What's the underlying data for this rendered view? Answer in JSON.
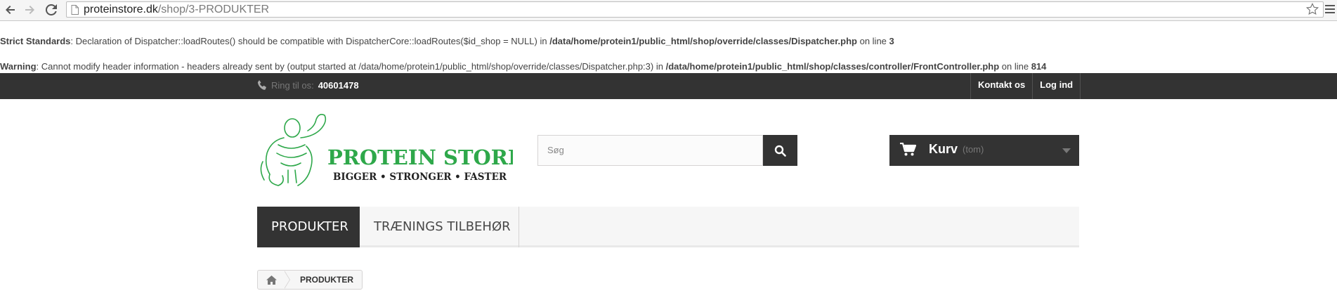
{
  "browser": {
    "url_domain": "proteinstore.dk",
    "url_path": "/shop/3-PRODUKTER"
  },
  "warnings": [
    {
      "label": "Strict Standards",
      "text": ": Declaration of Dispatcher::loadRoutes() should be compatible with DispatcherCore::loadRoutes($id_shop = NULL) in ",
      "file": "/data/home/protein1/public_html/shop/override/classes/Dispatcher.php",
      "line_text": " on line ",
      "line": "3"
    },
    {
      "label": "Warning",
      "text": ": Cannot modify header information - headers already sent by (output started at /data/home/protein1/public_html/shop/override/classes/Dispatcher.php:3) in ",
      "file": "/data/home/protein1/public_html/shop/classes/controller/FrontController.php",
      "line_text": " on line ",
      "line": "814"
    }
  ],
  "topbar": {
    "phone_label": "Ring til os:",
    "phone_number": "40601478",
    "links": [
      "Kontakt os",
      "Log ind"
    ]
  },
  "logo": {
    "title": "PROTEIN STORE",
    "tagline": "BIGGER • STRONGER • FASTER",
    "color": "#2ea84a"
  },
  "search": {
    "placeholder": "Søg"
  },
  "cart": {
    "label": "Kurv",
    "status": "(tom)"
  },
  "menu": {
    "items": [
      "PRODUKTER",
      "TRÆNINGS TILBEHØR"
    ],
    "active_index": 0
  },
  "breadcrumb": {
    "current": "PRODUKTER"
  }
}
